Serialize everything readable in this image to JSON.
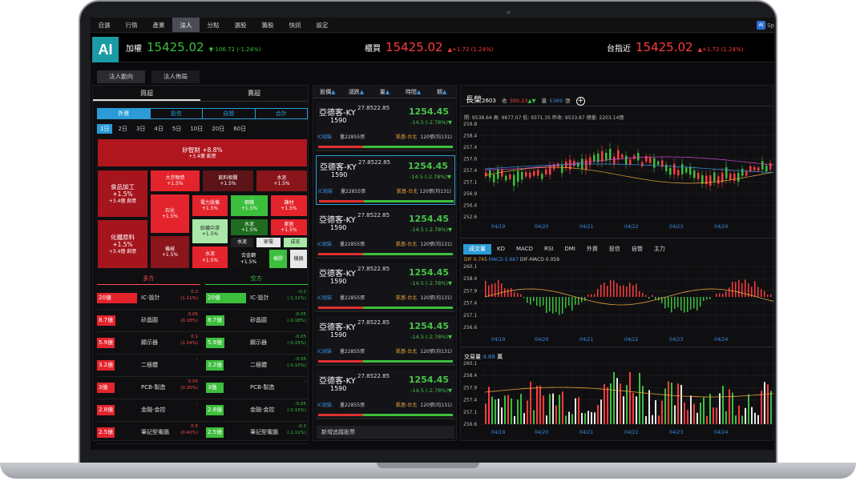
{
  "menu": [
    "自選",
    "行情",
    "產業",
    "法人",
    "分點",
    "選股",
    "籌股",
    "快訊",
    "設定"
  ],
  "menu_active": 3,
  "corner": {
    "icon": "AI",
    "label": "Sp"
  },
  "logo": "AI",
  "quotes": [
    {
      "name": "加權",
      "price": "15425.02",
      "change": "▼-106.72 (-1.24%)",
      "color": "#3cc03c"
    },
    {
      "name": "櫃買",
      "price": "15425.02",
      "change": "▲+1.72 (1.24%)",
      "color": "#ff3b3b"
    },
    {
      "name": "台指近",
      "price": "15425.02",
      "change": "▲+1.72 (1.24%)",
      "color": "#ff3b3b"
    }
  ],
  "subtabs": [
    "法人動向",
    "法人佈局"
  ],
  "left": {
    "headers": [
      "買超",
      "賣超"
    ],
    "segments": [
      "外資",
      "投信",
      "自營",
      "合計"
    ],
    "days": [
      "1日",
      "2日",
      "3日",
      "4日",
      "5日",
      "10日",
      "20日",
      "60日"
    ],
    "treemap": [
      {
        "name": "矽智財 +8.8%",
        "sub": "+3.4億 創意",
        "color": "#b0161e",
        "big": true
      },
      {
        "name": "食品加工",
        "pct": "+1.5%",
        "sub": "+3.4億 創意",
        "color": "#a5151d",
        "big": true
      },
      {
        "name": "大宗物資",
        "pct": "+1.5%",
        "color": "#e4242c"
      },
      {
        "name": "飲料相關",
        "pct": "+1.5%",
        "color": "#5c1418"
      },
      {
        "name": "水泥",
        "pct": "+1.5%",
        "color": "#8a151b"
      },
      {
        "name": "石化",
        "pct": "+1.5%",
        "color": "#e4242c"
      },
      {
        "name": "電力設備",
        "pct": "+1.5%",
        "color": "#e4242c"
      },
      {
        "name": "鋼鐵",
        "pct": "+1.5%",
        "color": "#3cbf3c"
      },
      {
        "name": "鍊材",
        "pct": "+1.5%",
        "color": "#e4242c"
      },
      {
        "name": "紡織中游",
        "pct": "+1.5%",
        "color": "#a9e8a9",
        "dark": true
      },
      {
        "name": "水泥",
        "pct": "+1.5%",
        "color": "#1f6b1f"
      },
      {
        "name": "家居",
        "pct": "+1.5%",
        "color": "#e4242c"
      },
      {
        "name": "化纖原料",
        "pct": "+1.5%",
        "sub": "+3.4億 創意",
        "color": "#a5151d",
        "big": true
      },
      {
        "name": "機械",
        "pct": "+1.5%",
        "color": "#8a151b"
      },
      {
        "name": "水泥",
        "color": "#222"
      },
      {
        "name": "家電",
        "color": "#e8e8e8",
        "dark": true
      },
      {
        "name": "成衣",
        "color": "#a9e8a9",
        "dark": true
      },
      {
        "name": "水泥",
        "pct": "+1.5%",
        "color": "#e4242c"
      },
      {
        "name": "合金鋼",
        "pct": "+1.5%",
        "color": "#111"
      },
      {
        "name": "橡膠",
        "color": "#3cbf3c"
      },
      {
        "name": "機器",
        "color": "#e8e8e8",
        "dark": true
      }
    ],
    "long_label": "多方",
    "short_label": "空方",
    "rows": [
      {
        "lv": "20億",
        "lw": 1,
        "ln": "IC-設計",
        "lc": "0.2",
        "lp": "(1.11%)",
        "sv": "20億",
        "sw": 1,
        "sn": "IC-設計",
        "sc": "-0.2",
        "sp": "(-1.11%)"
      },
      {
        "lv": "8.7億",
        "lw": 0.45,
        "ln": "矽晶圓",
        "lc": "0.05",
        "lp": "(0.18%)",
        "sv": "8.7億",
        "sw": 0.45,
        "sn": "矽晶圓",
        "sc": "-0.05",
        "sp": "(-0.18%)"
      },
      {
        "lv": "5.9億",
        "lw": 0.3,
        "ln": "顯示器",
        "lc": "0.1",
        "lp": "(1.14%)",
        "sv": "5.9億",
        "sw": 0.45,
        "sn": "顯示器",
        "sc": "-0.05",
        "sp": "(-0.15%)"
      },
      {
        "lv": "3.2億",
        "lw": 0.2,
        "ln": "二極體",
        "lc": "-",
        "lp": "",
        "sv": "3.2億",
        "sw": 0.3,
        "sn": "二極體",
        "sc": "-0.05",
        "sp": "(-0.15%)"
      },
      {
        "lv": "3億",
        "lw": 0.15,
        "ln": "PCB-製造",
        "lc": "0.05",
        "lp": "(0.35%)",
        "sv": "3億",
        "sw": 0.15,
        "sn": "PCB-製造",
        "sc": "-",
        "sp": ""
      },
      {
        "lv": "2.8億",
        "lw": 0.15,
        "ln": "金融-金控",
        "lc": "-",
        "lp": "",
        "sv": "2.8億",
        "sw": 0.15,
        "sn": "金融-金控",
        "sc": "-0.05",
        "sp": "(-0.15%)"
      },
      {
        "lv": "2.5億",
        "lw": 0.12,
        "ln": "筆記型電腦",
        "lc": "0.5",
        "lp": "(0.42%)",
        "sv": "2.5億",
        "sw": 0.12,
        "sn": "筆記型電腦",
        "sc": "-0.2",
        "sp": "(-1.11%)"
      }
    ]
  },
  "middle": {
    "headers": [
      {
        "t": "股價",
        "a": "▲"
      },
      {
        "t": "漲跌",
        "a": "▲"
      },
      {
        "t": "量",
        "a": "▲"
      },
      {
        "t": "時間",
        "a": "▲"
      },
      {
        "t": "期",
        "a": "▲"
      }
    ],
    "cards": [
      {
        "name": "亞德客-KY",
        "code": "1590",
        "price": "1254.45",
        "chg": "-14.5 (-2.78%)▼",
        "group": "IC組裝",
        "vol": "量22855張",
        "area": "凱基-台北",
        "deal": "120張(均131)",
        "y1": "27.85",
        "y2": "22.85"
      },
      {
        "name": "亞德客-KY",
        "code": "1590",
        "price": "1254.45",
        "chg": "-14.5 (-2.78%)▼",
        "group": "IC組裝",
        "vol": "量22855張",
        "area": "凱基-台北",
        "deal": "120張(均131)",
        "y1": "27.85",
        "y2": "22.85"
      },
      {
        "name": "亞德客-KY",
        "code": "1590",
        "price": "1254.45",
        "chg": "-14.5 (-2.78%)▼",
        "group": "IC組裝",
        "vol": "量22855張",
        "area": "凱基-台北",
        "deal": "120張(均131)",
        "y1": "27.85",
        "y2": "22.85"
      },
      {
        "name": "亞德客-KY",
        "code": "1590",
        "price": "1254.45",
        "chg": "-14.5 (-2.78%)▼",
        "group": "IC組裝",
        "vol": "量22855張",
        "area": "凱基-台北",
        "deal": "120張(均131)",
        "y1": "27.85",
        "y2": "22.85"
      },
      {
        "name": "亞德客-KY",
        "code": "1590",
        "price": "1254.45",
        "chg": "-14.5 (-2.78%)▼",
        "group": "IC組裝",
        "vol": "量22855張",
        "area": "凱基-台北",
        "deal": "120張(均131)",
        "y1": "27.85",
        "y2": "22.85"
      },
      {
        "name": "亞德客-KY",
        "code": "1590",
        "price": "1254.45",
        "chg": "-14.5 (-2.78%)▼",
        "group": "IC組裝",
        "vol": "量22855張",
        "area": "凱基-台北",
        "deal": "120張(均131)",
        "y1": "27.85",
        "y2": "22.85"
      }
    ],
    "add": "新增追蹤股票"
  },
  "right": {
    "name": "長榮",
    "code": "2603",
    "close_label": "收",
    "close": "390.23",
    "arrow": "▲▼",
    "vol_label": "量",
    "vol": "5369",
    "unit": "張",
    "ohlc": "開: 9538.64   高: 9677.07   低: 9371.35   昨收: 9533.87   總量: 2203.14億",
    "indicators": [
      "成交量",
      "KD",
      "MACD",
      "RSI",
      "DMI",
      "外資",
      "投信",
      "自營",
      "主力"
    ],
    "dif": "DIF 0.745",
    "macd": "MACD 0.687",
    "difmacd": "DIF-MACD 0.059",
    "vol_title": "交易量",
    "vol_val": "4.88",
    "vol_unit": "萬",
    "dates": [
      "04/19",
      "04/20",
      "04/21",
      "04/22",
      "04/23",
      "04/24"
    ],
    "axis1": [
      "259.8",
      "258.4",
      "257.4",
      "257.6",
      "257.4",
      "257.1",
      "256.9",
      "256.4",
      "252.6"
    ],
    "axis2": [
      "260.1",
      "258.4",
      "257.9",
      "257.4",
      "257.1",
      "256.6"
    ],
    "axis3": [
      "260.1",
      "258.4",
      "257.9",
      "257.4",
      "257.1",
      "256.6"
    ]
  }
}
